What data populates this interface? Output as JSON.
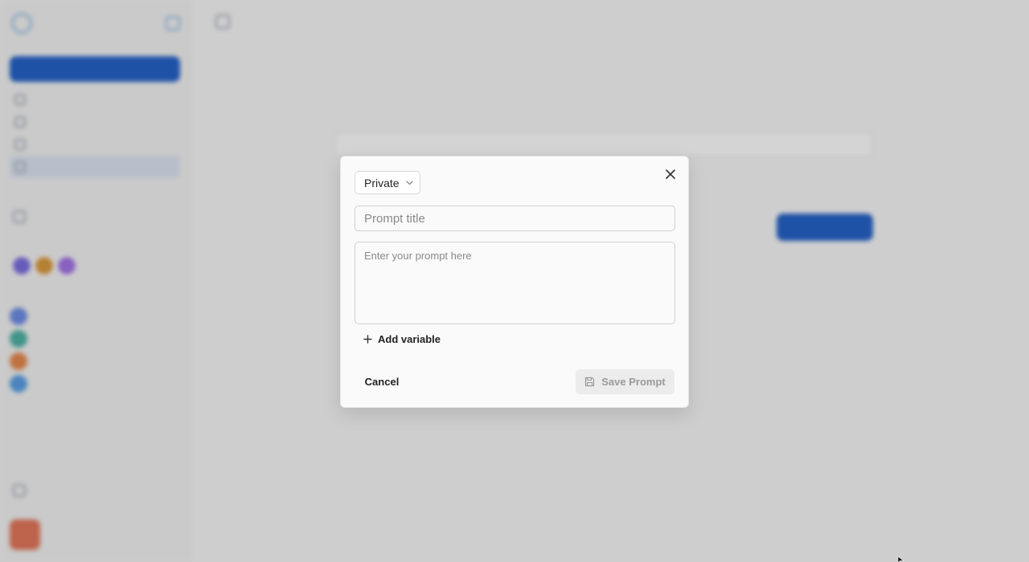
{
  "modal": {
    "visibility": {
      "selected": "Private"
    },
    "title_placeholder": "Prompt title",
    "prompt_placeholder": "Enter your prompt here",
    "add_variable_label": "Add variable",
    "cancel_label": "Cancel",
    "save_label": "Save Prompt"
  },
  "colors": {
    "primary": "#2563c9",
    "overlay": "rgba(0,0,0,0.17)",
    "save_disabled_bg": "#ececec",
    "save_disabled_text": "#9a9a9a"
  },
  "icons": {
    "close": "close-icon",
    "chevron": "chevron-down-icon",
    "plus": "plus-icon",
    "save": "floppy-disk-icon"
  }
}
